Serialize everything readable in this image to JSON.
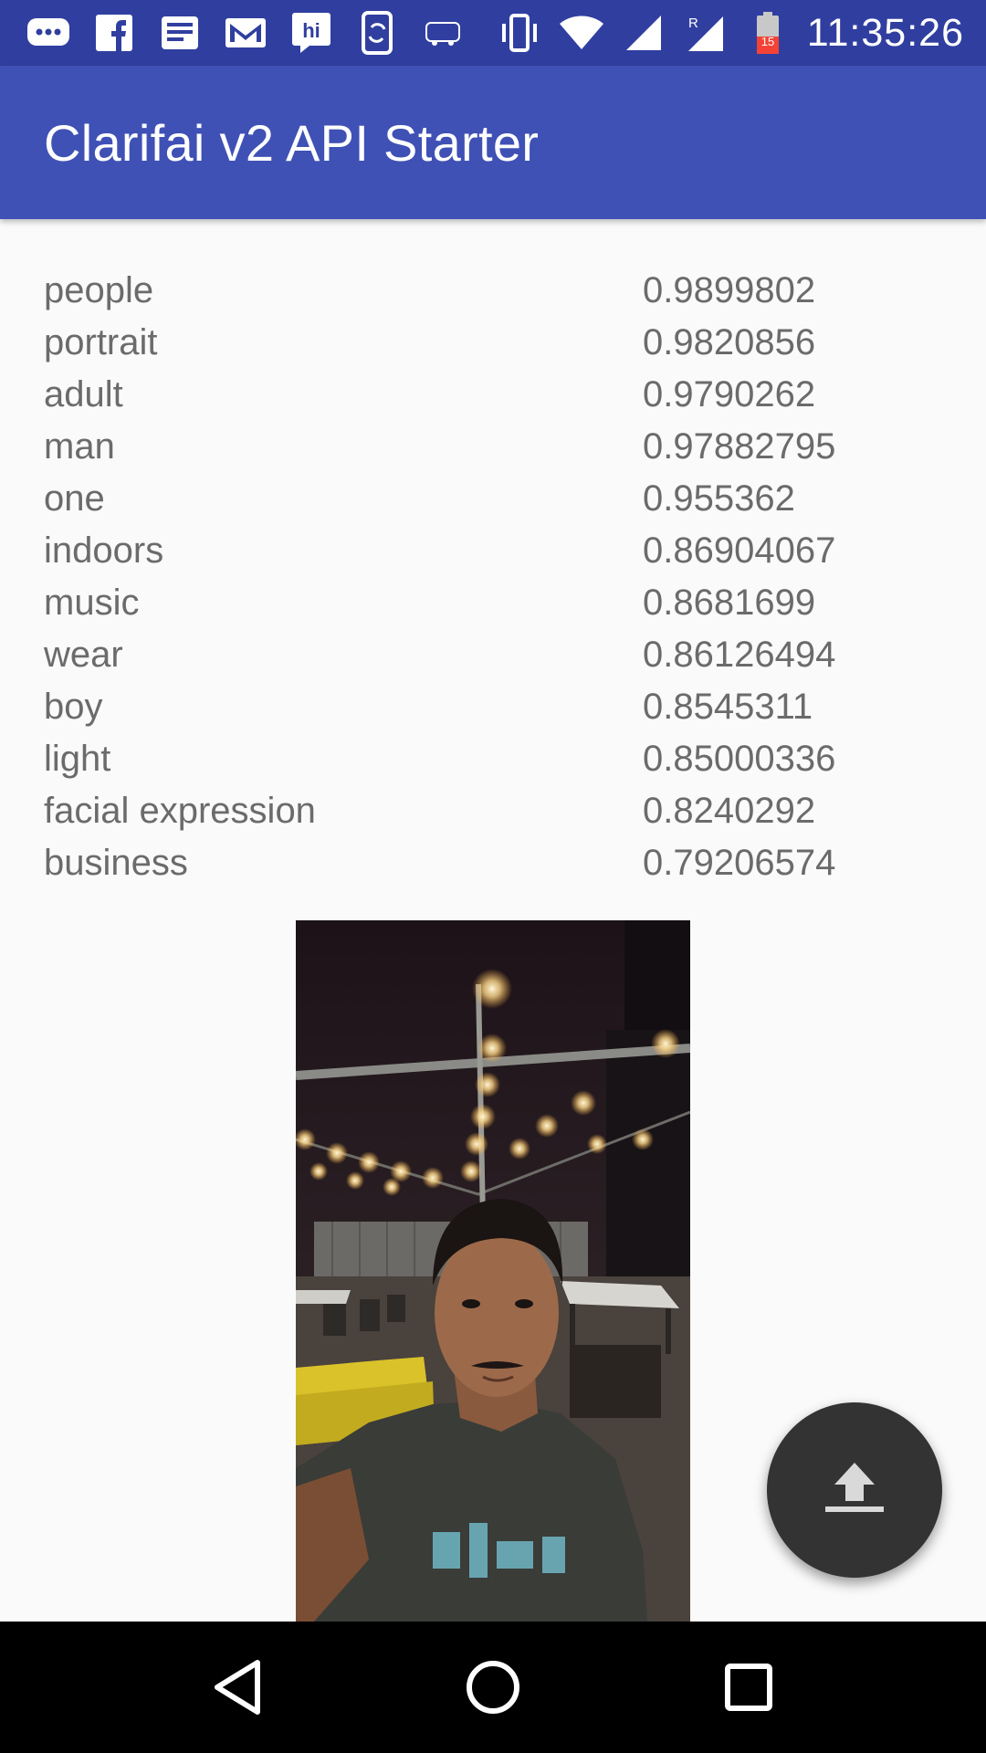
{
  "status_bar": {
    "time": "11:35:26",
    "notification_icons": [
      "messages-icon",
      "facebook-icon",
      "news-icon",
      "gmail-icon",
      "hike-icon",
      "phone-sync-icon",
      "redbus-icon"
    ],
    "system_icons": [
      "vibrate-icon",
      "wifi-icon",
      "signal-icon",
      "roaming-signal-icon",
      "battery-low-icon"
    ],
    "battery_level": "15"
  },
  "app_bar": {
    "title": "Clarifai v2 API Starter"
  },
  "tags": [
    {
      "name": "people",
      "score": "0.9899802"
    },
    {
      "name": "portrait",
      "score": "0.9820856"
    },
    {
      "name": "adult",
      "score": "0.9790262"
    },
    {
      "name": "man",
      "score": "0.97882795"
    },
    {
      "name": "one",
      "score": "0.955362"
    },
    {
      "name": "indoors",
      "score": "0.86904067"
    },
    {
      "name": "music",
      "score": "0.8681699"
    },
    {
      "name": "wear",
      "score": "0.86126494"
    },
    {
      "name": "boy",
      "score": "0.8545311"
    },
    {
      "name": "light",
      "score": "0.85000336"
    },
    {
      "name": "facial expression",
      "score": "0.8240292"
    },
    {
      "name": "business",
      "score": "0.79206574"
    }
  ],
  "fab": {
    "icon": "upload-icon"
  },
  "nav_bar": {
    "icons": [
      "back-icon",
      "home-icon",
      "recents-icon"
    ]
  },
  "colors": {
    "status_bar": "#303f9f",
    "app_bar": "#3f51b5",
    "text": "#6b6b6b",
    "fab": "#333333"
  }
}
